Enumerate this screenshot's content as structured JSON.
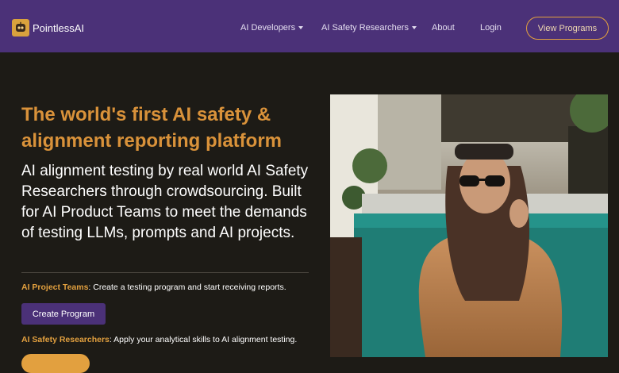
{
  "brand": {
    "name": "PointlessAI",
    "logo_icon": "robot-face-icon"
  },
  "nav": {
    "items": [
      {
        "label": "AI Developers",
        "dropdown": true
      },
      {
        "label": "AI Safety Researchers",
        "dropdown": true
      },
      {
        "label": "About",
        "dropdown": false
      },
      {
        "label": "Login",
        "dropdown": false
      }
    ],
    "cta_label": "View Programs"
  },
  "hero": {
    "title": "The world's first AI safety & alignment reporting platform",
    "lead": "AI alignment testing by real world AI Safety Researchers through crowdsourcing. Built for AI Product Teams to meet the demands of testing LLMs, prompts and AI projects.",
    "project_teams": {
      "label": "AI Project Teams",
      "text": ": Create a testing program and start receiving reports."
    },
    "create_program_label": "Create Program",
    "researchers": {
      "label": "AI Safety Researchers",
      "text": ": Apply your analytical skills to AI alignment testing."
    }
  },
  "colors": {
    "nav_bg": "#4b3178",
    "page_bg": "#1d1b16",
    "accent": "#e2a03f",
    "title": "#d9923a"
  }
}
